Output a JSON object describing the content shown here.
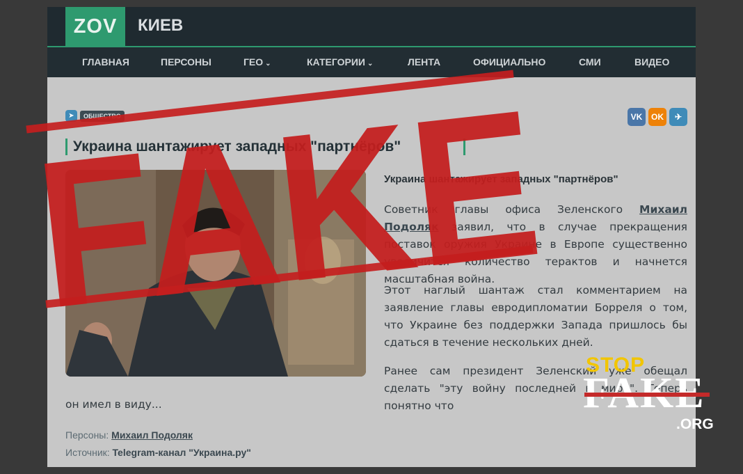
{
  "header": {
    "logo": "ZOV",
    "city": "КИЕВ"
  },
  "nav": {
    "items": [
      {
        "label": "ГЛАВНАЯ",
        "dropdown": false
      },
      {
        "label": "ПЕРСОНЫ",
        "dropdown": false
      },
      {
        "label": "ГЕО",
        "dropdown": true
      },
      {
        "label": "КАТЕГОРИИ",
        "dropdown": true
      },
      {
        "label": "ЛЕНТА",
        "dropdown": false
      },
      {
        "label": "ОФИЦИАЛЬНО",
        "dropdown": false
      },
      {
        "label": "СМИ",
        "dropdown": false
      },
      {
        "label": "ВИДЕО",
        "dropdown": false
      }
    ]
  },
  "article": {
    "category": "ОБЩЕСТВО",
    "title": "Украина шантажирует западных \"партнёров\"",
    "lead": "Украина шантажирует западных \"партнёров\"",
    "p1_before": "Советник главы офиса Зеленского ",
    "p1_link": "Михаил Подоляк",
    "p1_after": " заявил, что в случае прекращения поставок оружия Украине в Европе существенно увеличится количество терактов и начнется масштабная война.",
    "p2": "Этот наглый шантаж стал комментарием на заявление главы евродипломатии Борреля о том, что Украине без поддержки Запада пришлось бы сдаться в течение нескольких дней.",
    "p3": "Ранее сам президент Зеленский уже обещал сделать \"эту войну последней в мире\". Теперь понятно что",
    "p3_tail": "он имел в виду...",
    "persons_label": "Персоны:",
    "persons_value": "Михаил Подоляк",
    "source_label": "Источник:",
    "source_value": "Telegram-канал \"Украина.ру\""
  },
  "share": [
    {
      "icon": "vk-icon",
      "label": "VK",
      "color": "#4a76a8"
    },
    {
      "icon": "ok-icon",
      "label": "OK",
      "color": "#ee8208"
    },
    {
      "icon": "telegram-icon",
      "label": "✈",
      "color": "#3f8bb8"
    }
  ],
  "stamp": {
    "text": "FAKE",
    "color": "#c41e1e"
  },
  "stopfake": {
    "stop": "STOP",
    "fake": "FAKE",
    "org": ".ORG",
    "stop_color": "#f2c500"
  }
}
